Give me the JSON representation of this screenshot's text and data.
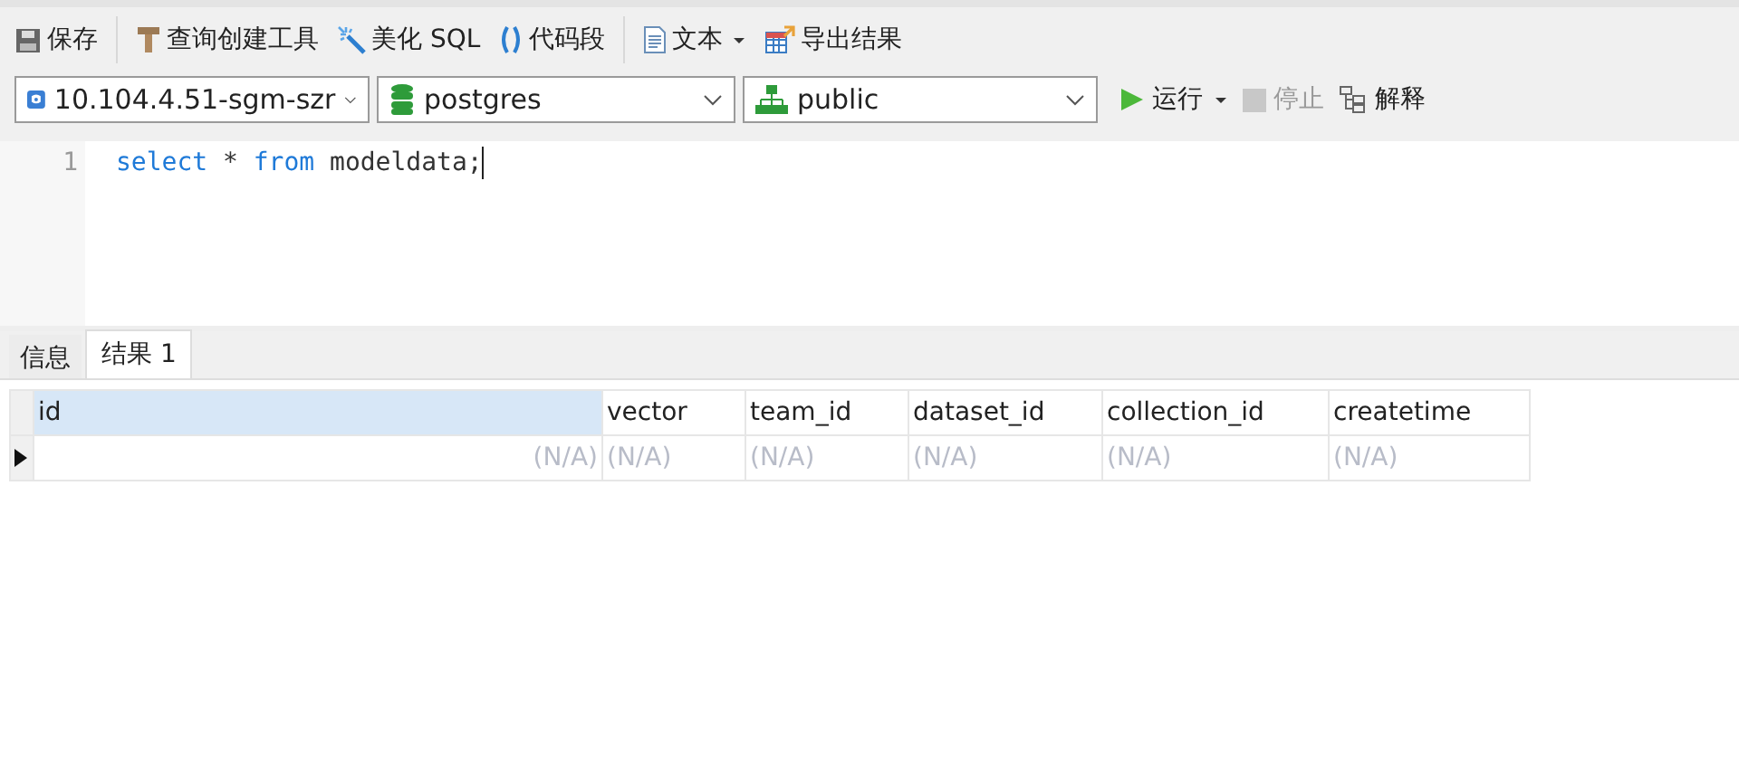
{
  "toolbar": {
    "groups": [
      [
        {
          "label": "保存",
          "dropdown": false
        }
      ],
      [
        {
          "label": "查询创建工具",
          "dropdown": false
        },
        {
          "label": "美化 SQL",
          "dropdown": false
        },
        {
          "label": "代码段",
          "dropdown": false
        }
      ],
      [
        {
          "label": "文本",
          "dropdown": true
        },
        {
          "label": "导出结果",
          "dropdown": false
        }
      ]
    ]
  },
  "selectors": [
    {
      "value": "10.104.4.51-sgm-szr"
    },
    {
      "value": "postgres"
    },
    {
      "value": "public"
    }
  ],
  "actions": [
    {
      "label": "运行",
      "dropdown": true,
      "disabled": false
    },
    {
      "label": "停止",
      "dropdown": false,
      "disabled": true
    },
    {
      "label": "解释",
      "dropdown": false,
      "disabled": false
    }
  ],
  "editor": {
    "lines": [
      {
        "number": "1",
        "cursor": true,
        "tokens": [
          {
            "text": "select",
            "kind": "keyword"
          },
          {
            "text": " * ",
            "kind": "plain"
          },
          {
            "text": "from",
            "kind": "keyword"
          },
          {
            "text": " modeldata;",
            "kind": "plain"
          }
        ]
      }
    ]
  },
  "tabs": [
    {
      "label": "信息",
      "selected": false
    },
    {
      "label": "结果 1",
      "selected": true
    }
  ],
  "table": {
    "columns": [
      {
        "name": "id",
        "kind": "number",
        "selected": true
      },
      {
        "name": "vector",
        "kind": "text",
        "selected": false
      },
      {
        "name": "team_id",
        "kind": "text",
        "selected": false
      },
      {
        "name": "dataset_id",
        "kind": "text",
        "selected": false
      },
      {
        "name": "collection_id",
        "kind": "text",
        "selected": false
      },
      {
        "name": "createtime",
        "kind": "text",
        "selected": false
      }
    ],
    "rows": [
      {
        "current": true,
        "cells": [
          "(N/A)",
          "(N/A)",
          "(N/A)",
          "(N/A)",
          "(N/A)",
          "(N/A)"
        ]
      }
    ]
  }
}
